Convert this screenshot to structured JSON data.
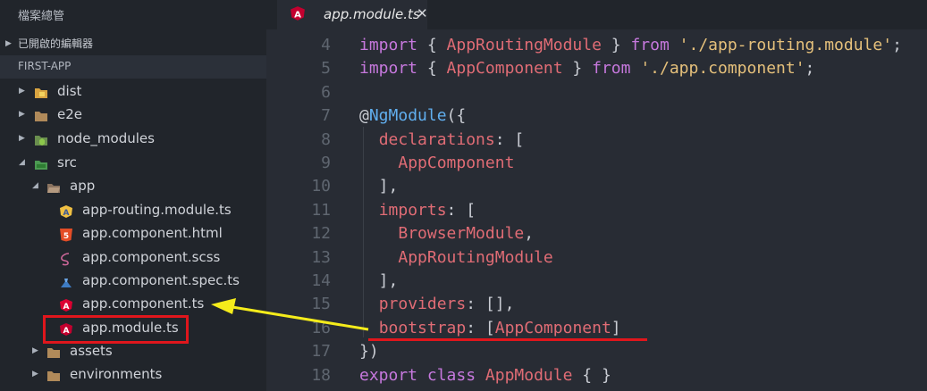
{
  "sidebar": {
    "title": "檔案總管",
    "open_editors_label": "已開啟的編輯器",
    "project_label": "FIRST-APP",
    "items": [
      {
        "name": "dist",
        "icon": "folder-dist-icon"
      },
      {
        "name": "e2e",
        "icon": "folder-icon"
      },
      {
        "name": "node_modules",
        "icon": "folder-node-icon"
      },
      {
        "name": "src",
        "icon": "folder-src-icon"
      },
      {
        "name": "app",
        "icon": "folder-open-icon"
      },
      {
        "name": "app-routing.module.ts",
        "icon": "angular-routing-icon"
      },
      {
        "name": "app.component.html",
        "icon": "html5-icon"
      },
      {
        "name": "app.component.scss",
        "icon": "sass-icon"
      },
      {
        "name": "app.component.spec.ts",
        "icon": "test-icon"
      },
      {
        "name": "app.component.ts",
        "icon": "angular-component-icon"
      },
      {
        "name": "app.module.ts",
        "icon": "angular-icon"
      },
      {
        "name": "assets",
        "icon": "folder-icon"
      },
      {
        "name": "environments",
        "icon": "folder-icon"
      }
    ]
  },
  "tab": {
    "label": "app.module.ts",
    "close": "✕"
  },
  "editor": {
    "line_numbers": [
      "4",
      "5",
      "6",
      "7",
      "8",
      "9",
      "10",
      "11",
      "12",
      "13",
      "14",
      "15",
      "16",
      "17",
      "18"
    ]
  },
  "colors": {
    "annotation_red": "#e0161c",
    "annotation_yellow": "#f5ec1b",
    "keyword": "#c678dd",
    "identifier": "#e06c75",
    "string": "#e5c07b",
    "decorator": "#61afef"
  }
}
